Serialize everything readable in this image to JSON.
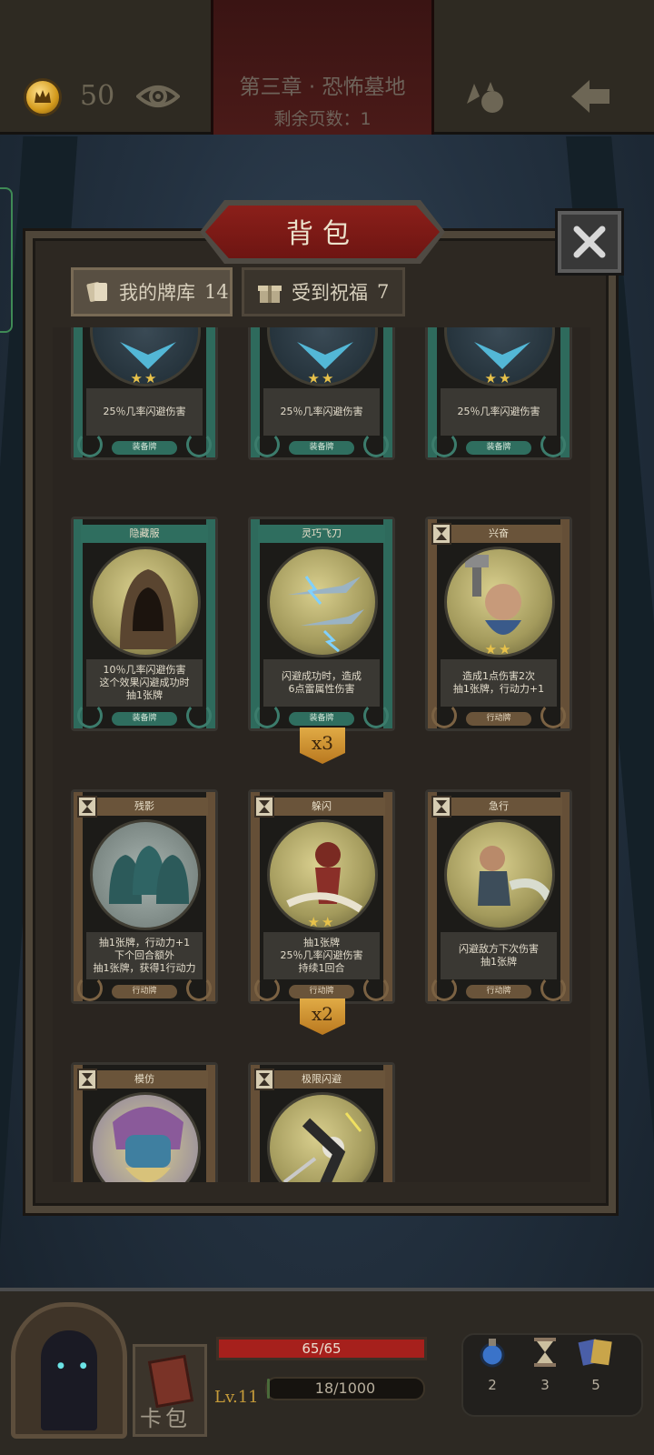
{
  "topbar": {
    "coins": "50",
    "chapter_title": "第三章 · 恐怖墓地",
    "pages_left": "剩余页数：1"
  },
  "panel": {
    "title": "背包",
    "tabs": [
      {
        "label": "我的牌库",
        "count": "14",
        "active": true
      },
      {
        "label": "受到祝福",
        "count": "7",
        "active": false
      }
    ]
  },
  "cards": [
    {
      "name": "",
      "stars": "★★",
      "desc": "25％几率闪避伤害",
      "type": "装备牌"
    },
    {
      "name": "",
      "stars": "★★",
      "desc": "25％几率闪避伤害",
      "type": "装备牌"
    },
    {
      "name": "",
      "stars": "★★",
      "desc": "25％几率闪避伤害",
      "type": "装备牌"
    },
    {
      "name": "隐藏服",
      "stars": "",
      "desc": "10％几率闪避伤害\n这个效果闪避成功时\n抽1张牌",
      "type": "装备牌"
    },
    {
      "name": "灵巧飞刀",
      "stars": "",
      "desc": "闪避成功时，造成\n6点雷属性伤害",
      "type": "装备牌",
      "count": "x3"
    },
    {
      "name": "兴奋",
      "stars": "★★",
      "desc": "造成1点伤害2次\n抽1张牌，行动力+1",
      "type": "行动牌"
    },
    {
      "name": "残影",
      "stars": "",
      "desc": "抽1张牌，行动力+1\n下个回合额外\n抽1张牌，获得1行动力",
      "type": "行动牌"
    },
    {
      "name": "躲闪",
      "stars": "★★",
      "desc": "抽1张牌\n25％几率闪避伤害\n持续1回合",
      "type": "行动牌",
      "count": "x2"
    },
    {
      "name": "急行",
      "stars": "",
      "desc": "闪避敌方下次伤害\n抽1张牌",
      "type": "行动牌"
    },
    {
      "name": "模仿",
      "stars": "",
      "desc": "",
      "type": ""
    },
    {
      "name": "极限闪避",
      "stars": "",
      "desc": "",
      "type": ""
    }
  ],
  "hud": {
    "deck_label": "卡包",
    "hp": "65/65",
    "hp_fraction": 1.0,
    "level": "Lv.11",
    "xp": "18/1000",
    "xp_fraction": 0.018,
    "resources": [
      {
        "icon": "potion-icon",
        "count": "2"
      },
      {
        "icon": "hourglass-icon",
        "count": "3"
      },
      {
        "icon": "cards-icon",
        "count": "5"
      }
    ]
  },
  "colors": {
    "equip_green": "#2f6e5f",
    "action_brown": "#6a543a",
    "title_red": "#8b1f1a",
    "hp_red": "#a6201c",
    "gold": "#e1ab45"
  }
}
